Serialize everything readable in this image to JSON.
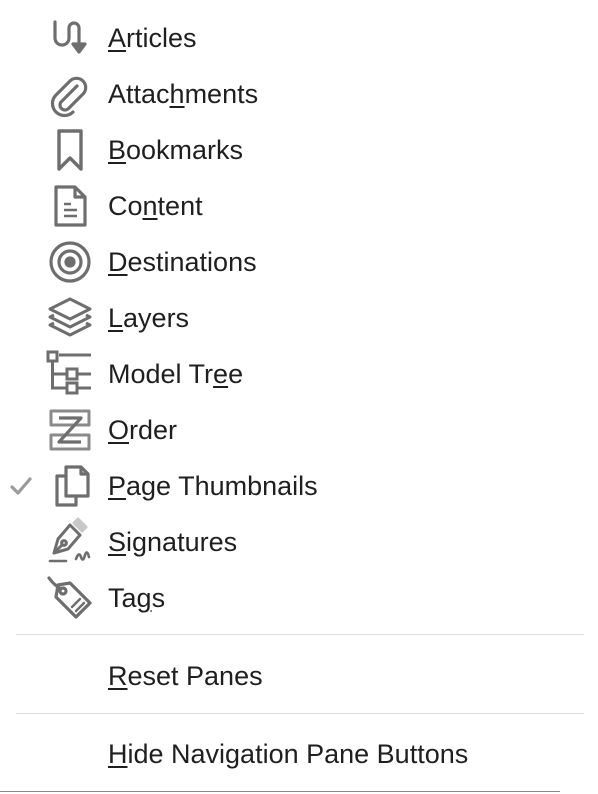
{
  "menu": {
    "items": [
      {
        "label": "Articles",
        "icon": "articles-icon",
        "checked": false
      },
      {
        "label": "Attachments",
        "icon": "paperclip-icon",
        "checked": false
      },
      {
        "label": "Bookmarks",
        "icon": "bookmark-icon",
        "checked": false
      },
      {
        "label": "Content",
        "icon": "document-icon",
        "checked": false
      },
      {
        "label": "Destinations",
        "icon": "target-icon",
        "checked": false
      },
      {
        "label": "Layers",
        "icon": "layers-icon",
        "checked": false
      },
      {
        "label": "Model Tree",
        "icon": "tree-icon",
        "checked": false
      },
      {
        "label": "Order",
        "icon": "order-icon",
        "checked": false
      },
      {
        "label": "Page Thumbnails",
        "icon": "pages-icon",
        "checked": true
      },
      {
        "label": "Signatures",
        "icon": "pen-icon",
        "checked": false
      },
      {
        "label": "Tags",
        "icon": "tag-icon",
        "checked": false
      }
    ],
    "reset_label": "Reset Panes",
    "hide_label": "Hide Navigation Pane Buttons"
  },
  "colors": {
    "icon": "#6e6e6e",
    "text": "#1f1f1f",
    "separator": "#dcdcdc",
    "check": "#9a9a9a"
  }
}
